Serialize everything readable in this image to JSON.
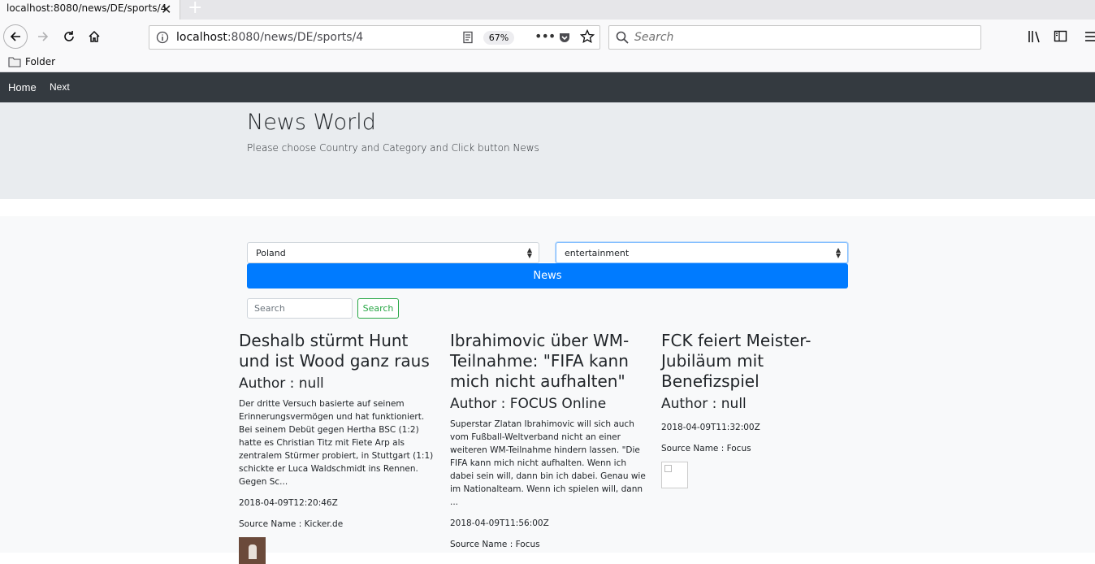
{
  "browser": {
    "tab_title": "localhost:8080/news/DE/sports/4",
    "url_host": "localhost",
    "url_rest": ":8080/news/DE/sports/4",
    "zoom": "67%",
    "search_placeholder": "Search",
    "bookmark_folder": "Folder"
  },
  "site": {
    "nav": {
      "home": "Home",
      "next": "Next"
    },
    "title": "News World",
    "subtitle": "Please choose Country and Category and Click button News",
    "country_selected": "Poland",
    "category_selected": "entertainment",
    "news_button": "News",
    "search_placeholder": "Search",
    "search_button": "Search"
  },
  "articles": [
    {
      "title": "Deshalb stürmt Hunt und ist Wood ganz raus",
      "author": "Author : null",
      "description": "Der dritte Versuch basierte auf seinem Erinnerungsvermögen und hat funktioniert. Bei seinem Debüt gegen Hertha BSC (1:2) hatte es Christian Titz mit Fiete Arp als zentralem Stürmer probiert, in Stuttgart (1:1) schickte er Luca Waldschmidt ins Rennen. Gegen Sc...",
      "date": "2018-04-09T12:20:46Z",
      "source": "Source Name : Kicker.de"
    },
    {
      "title": "Ibrahimovic über WM-Teilnahme: \"FIFA kann mich nicht aufhalten\"",
      "author": "Author : FOCUS Online",
      "description": "Superstar Zlatan Ibrahimovic will sich auch vom Fußball-Weltverband nicht an einer weiteren WM-Teilnahme hindern lassen. \"Die FIFA kann mich nicht aufhalten. Wenn ich dabei sein will, dann bin ich dabei. Genau wie im Nationalteam. Wenn ich spielen will, dann ...",
      "date": "2018-04-09T11:56:00Z",
      "source": "Source Name : Focus"
    },
    {
      "title": "FCK feiert Meister-Jubiläum mit Benefizspiel",
      "author": "Author : null",
      "description": "",
      "date": "2018-04-09T11:32:00Z",
      "source": "Source Name : Focus"
    }
  ]
}
